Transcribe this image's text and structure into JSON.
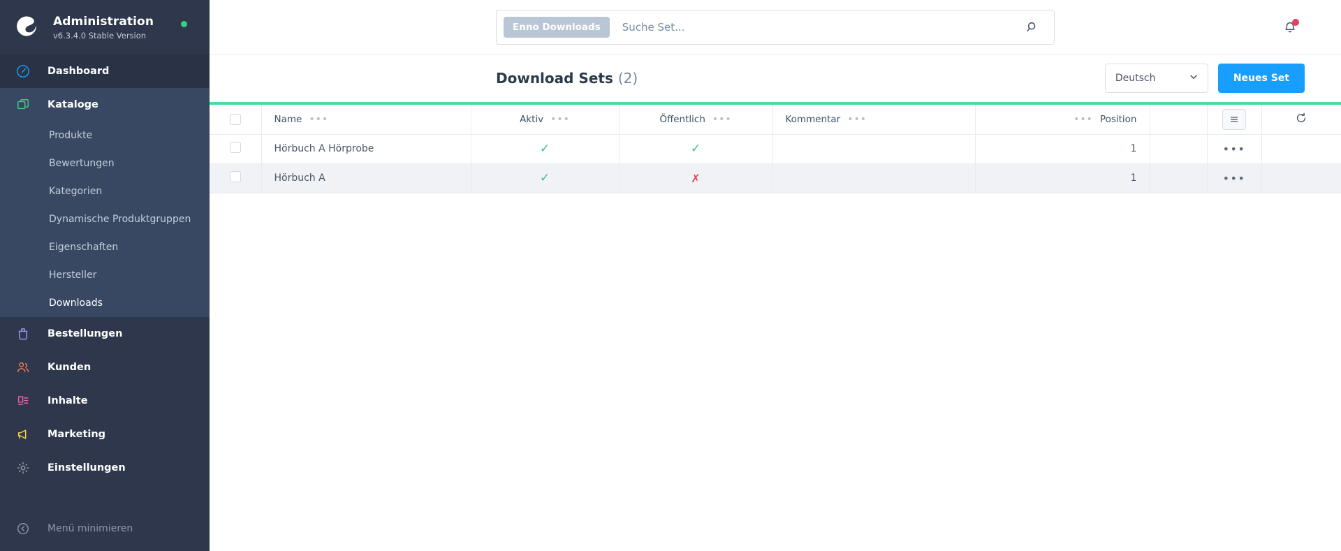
{
  "sidebar": {
    "brand": {
      "title": "Administration",
      "version": "v6.3.4.0 Stable Version",
      "logo_icon": "shopware-logo-icon",
      "status_dot_color": "#37d183"
    },
    "items": [
      {
        "label": "Dashboard",
        "icon": "dashboard-icon",
        "color": "#189eff",
        "active": true
      },
      {
        "label": "Kataloge",
        "icon": "catalogues-icon",
        "color": "#37d183",
        "expanded": true
      },
      {
        "label": "Bestellungen",
        "icon": "orders-icon",
        "color": "#a092f0"
      },
      {
        "label": "Kunden",
        "icon": "customers-icon",
        "color": "#ef7f4c"
      },
      {
        "label": "Inhalte",
        "icon": "content-icon",
        "color": "#ed5db0"
      },
      {
        "label": "Marketing",
        "icon": "marketing-icon",
        "color": "#f8d147"
      },
      {
        "label": "Einstellungen",
        "icon": "settings-gear-icon",
        "color": "#9aa5b5"
      }
    ],
    "kataloge_sub": [
      {
        "label": "Produkte",
        "active": false
      },
      {
        "label": "Bewertungen",
        "active": false
      },
      {
        "label": "Kategorien",
        "active": false
      },
      {
        "label": "Dynamische Produktgruppen",
        "active": false
      },
      {
        "label": "Eigenschaften",
        "active": false
      },
      {
        "label": "Hersteller",
        "active": false
      },
      {
        "label": "Downloads",
        "active": true
      }
    ],
    "footer": {
      "label": "Menü minimieren",
      "icon": "collapse-left-icon"
    }
  },
  "topbar": {
    "search_tag": "Enno Downloads",
    "search_placeholder": "Suche Set...",
    "search_value": "",
    "search_icon": "search-icon",
    "bell_icon": "bell-icon",
    "bell_has_notification": true
  },
  "pagehead": {
    "title": "Download Sets",
    "count": "(2)",
    "language": "Deutsch",
    "language_caret_icon": "chevron-down-icon",
    "new_button": "Neues Set"
  },
  "table": {
    "loading_bar_color": "#4ed9a0",
    "columns": [
      {
        "key": "name",
        "label": "Name",
        "align": "left",
        "has_menu": true
      },
      {
        "key": "aktiv",
        "label": "Aktiv",
        "align": "center",
        "has_menu": true
      },
      {
        "key": "oeffentlich",
        "label": "Öffentlich",
        "align": "center",
        "has_menu": true
      },
      {
        "key": "kommentar",
        "label": "Kommentar",
        "align": "left",
        "has_menu": true
      },
      {
        "key": "position",
        "label": "Position",
        "align": "right",
        "has_menu": true
      }
    ],
    "grid_settings_icon": "list-settings-icon",
    "refresh_icon": "refresh-icon",
    "row_context_icon": "context-menu-dots-icon",
    "rows": [
      {
        "name": "Hörbuch A Hörprobe",
        "aktiv": "✓",
        "oeffentlich": "✓",
        "kommentar": "",
        "position": "1"
      },
      {
        "name": "Hörbuch A",
        "aktiv": "✓",
        "oeffentlich": "✗",
        "kommentar": "",
        "position": "1"
      }
    ]
  }
}
